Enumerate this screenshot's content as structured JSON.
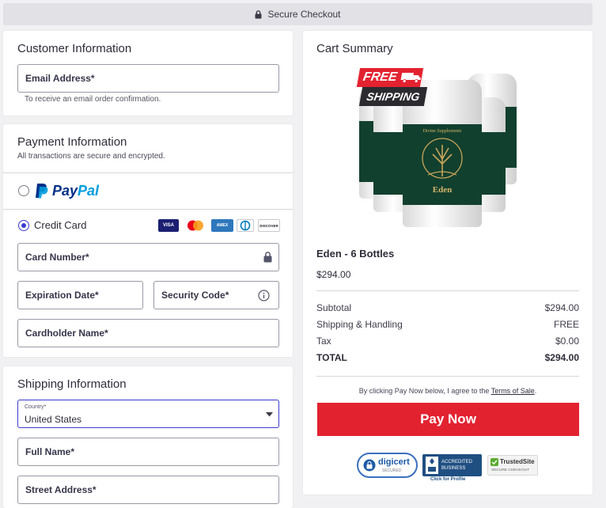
{
  "topbar": {
    "label": "Secure Checkout"
  },
  "customer": {
    "heading": "Customer Information",
    "email_label": "Email Address*",
    "email_hint": "To receive an email order confirmation."
  },
  "payment": {
    "heading": "Payment Information",
    "subheading": "All transactions are secure and encrypted.",
    "paypal_pay": "Pay",
    "paypal_pal": "Pal",
    "credit_card_label": "Credit Card",
    "selected_method": "Credit Card",
    "card_brands": [
      "VISA",
      "AMEX",
      "DISCOVER"
    ],
    "card_number_label": "Card Number*",
    "expiration_label": "Expiration Date*",
    "security_code_label": "Security Code*",
    "cardholder_label": "Cardholder Name*"
  },
  "shipping": {
    "heading": "Shipping Information",
    "country_label": "Country*",
    "country_value": "United States",
    "full_name_label": "Full Name*",
    "street_label": "Street Address*"
  },
  "cart": {
    "heading": "Cart Summary",
    "promo_free": "FREE",
    "promo_shipping": "SHIPPING",
    "bottle_brand": "Divine Supplements",
    "bottle_name": "Eden",
    "product_name": "Eden - 6 Bottles",
    "product_price": "$294.00",
    "rows": [
      {
        "label": "Subtotal",
        "value": "$294.00"
      },
      {
        "label": "Shipping & Handling",
        "value": "FREE"
      },
      {
        "label": "Tax",
        "value": "$0.00"
      }
    ],
    "total_label": "TOTAL",
    "total_value": "$294.00",
    "terms_prefix": "By clicking Pay Now below, I agree to the ",
    "terms_link": "Terms of Sale",
    "terms_suffix": ".",
    "pay_button": "Pay Now",
    "badges": {
      "digicert": "digicert",
      "digicert_sub": "SECURED",
      "bbb_line1": "ACCREDITED",
      "bbb_line2": "BUSINESS",
      "bbb_link": "Click for Profile",
      "trusted_title": "TrustedSite",
      "trusted_sub": "SECURE CHECKOUT"
    }
  },
  "colors": {
    "accent": "#3b3bd0",
    "pay_button": "#e32230",
    "label_green": "#12402e",
    "paypal_dark": "#003087",
    "paypal_light": "#009cde"
  }
}
